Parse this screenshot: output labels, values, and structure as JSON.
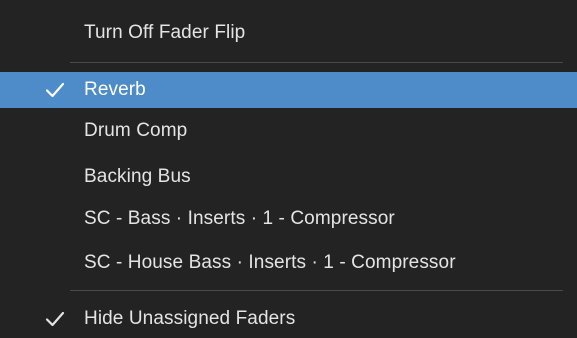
{
  "menu": {
    "items": [
      {
        "label": "Turn Off Fader Flip",
        "checked": false,
        "selected": false
      },
      {
        "label": "Reverb",
        "checked": true,
        "selected": true
      },
      {
        "label": "Drum Comp",
        "checked": false,
        "selected": false
      },
      {
        "label": "Backing Bus",
        "checked": false,
        "selected": false
      },
      {
        "label": "SC - Bass · Inserts · 1 - Compressor",
        "checked": false,
        "selected": false
      },
      {
        "label": "SC - House Bass · Inserts · 1 - Compressor",
        "checked": false,
        "selected": false
      },
      {
        "label": "Hide Unassigned Faders",
        "checked": true,
        "selected": false
      }
    ],
    "check_icon": "checkmark-icon"
  },
  "colors": {
    "background": "#232323",
    "highlight": "#4d8cc8",
    "text": "#e4e4e4",
    "separator": "#4a4a4a"
  }
}
